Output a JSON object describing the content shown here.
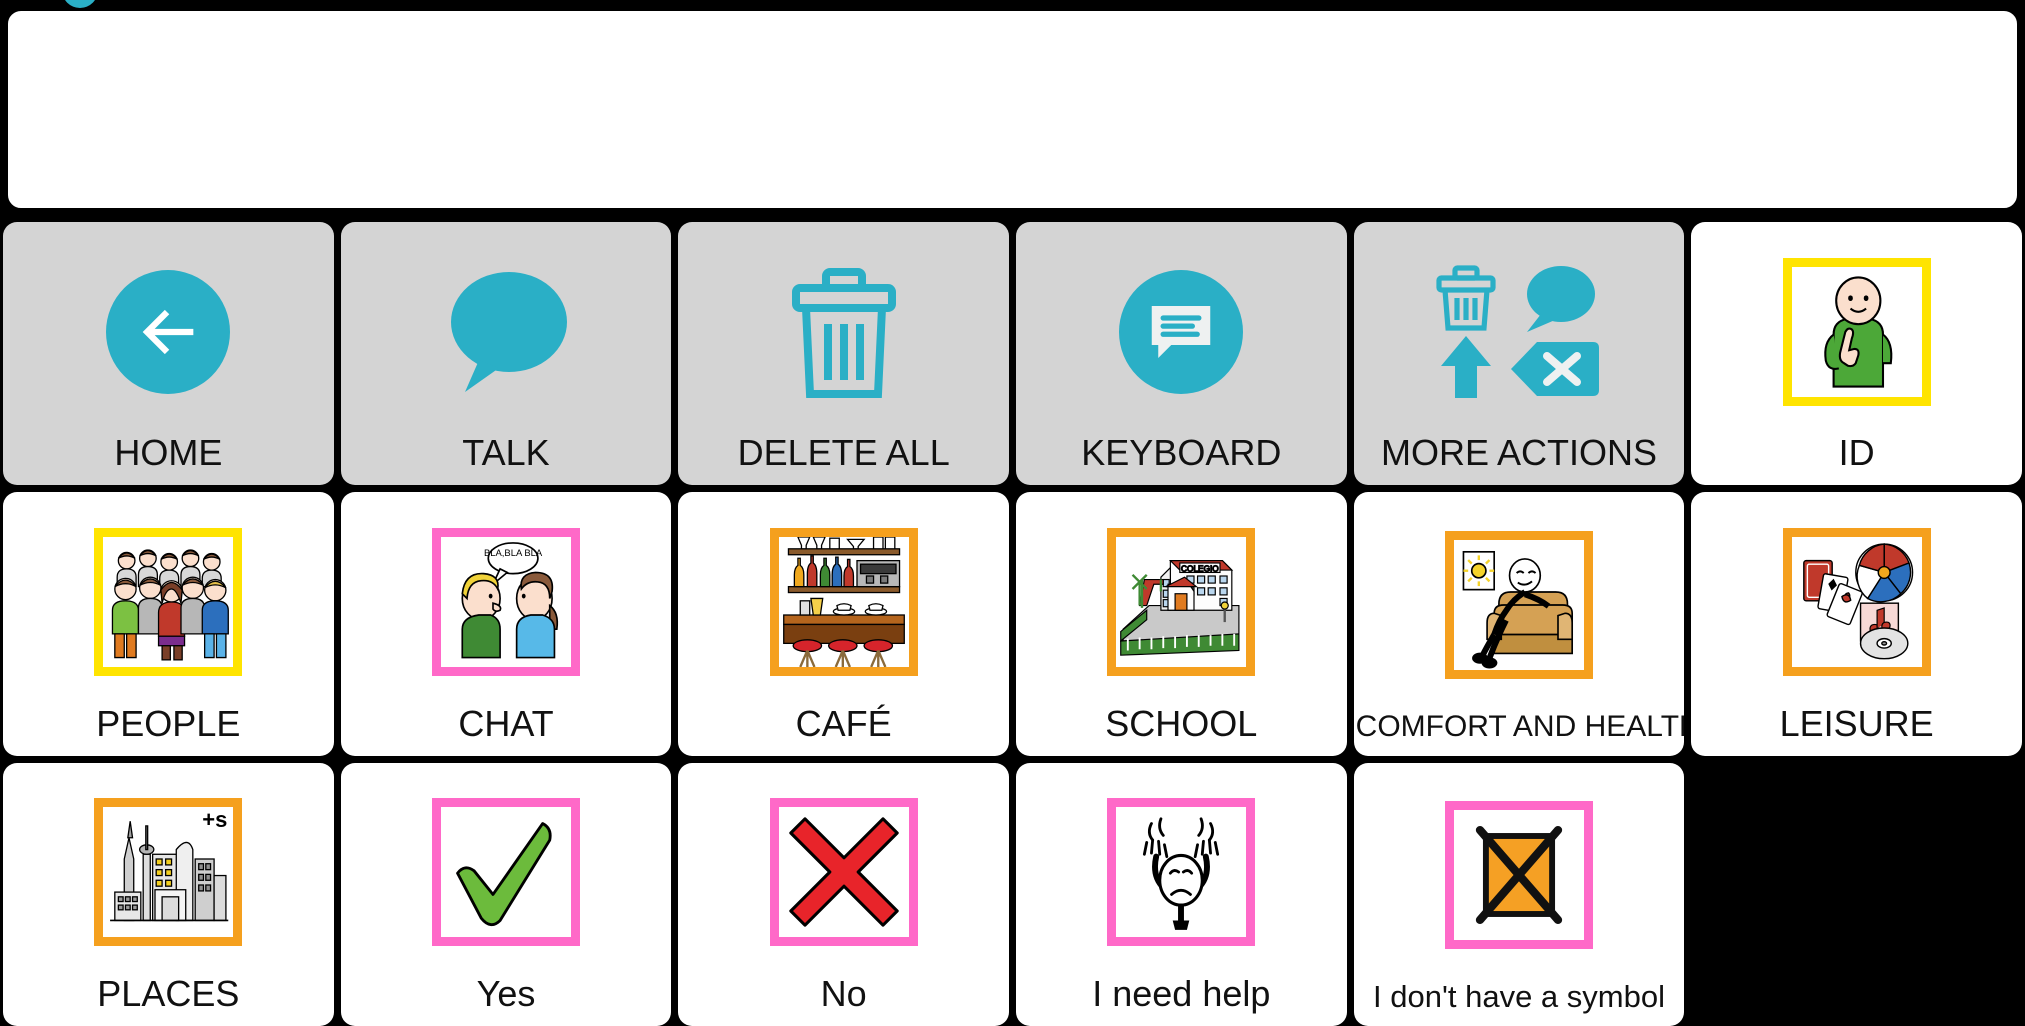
{
  "app": {
    "accent_teal": "#2aafc6",
    "toolbar_bg": "#d4d4d4",
    "frame_yellow": "#ffe400",
    "frame_pink": "#ff69c8",
    "frame_orange": "#f5a01e"
  },
  "message_bar": {
    "value": "",
    "placeholder": ""
  },
  "grid": {
    "columns": 6,
    "rows": 3,
    "cells": [
      {
        "label": "HOME",
        "icon": "back-arrow-icon",
        "kind": "toolbar"
      },
      {
        "label": "TALK",
        "icon": "speech-bubble-icon",
        "kind": "toolbar"
      },
      {
        "label": "DELETE ALL",
        "icon": "trash-can-icon",
        "kind": "toolbar"
      },
      {
        "label": "KEYBOARD",
        "icon": "keyboard-chat-icon",
        "kind": "toolbar"
      },
      {
        "label": "MORE ACTIONS",
        "icon": "more-actions-icon",
        "kind": "toolbar"
      },
      {
        "label": "ID",
        "icon": "person-pointing-self-icon",
        "kind": "symbol",
        "frame": "yellow"
      },
      {
        "label": "PEOPLE",
        "icon": "group-of-people-icon",
        "kind": "symbol",
        "frame": "yellow"
      },
      {
        "label": "CHAT",
        "icon": "two-people-talking-icon",
        "kind": "symbol",
        "frame": "pink",
        "bubble_text": "BLA,BLA BLA"
      },
      {
        "label": "CAFÉ",
        "icon": "bar-counter-icon",
        "kind": "symbol",
        "frame": "orange"
      },
      {
        "label": "SCHOOL",
        "icon": "school-building-icon",
        "kind": "symbol",
        "frame": "orange",
        "sign_text": "COLEGIO"
      },
      {
        "label": "COMFORT AND HEALTH",
        "icon": "person-in-armchair-icon",
        "kind": "symbol",
        "frame": "orange"
      },
      {
        "label": "LEISURE",
        "icon": "cards-ball-music-icon",
        "kind": "symbol",
        "frame": "orange"
      },
      {
        "label": "PLACES",
        "icon": "city-skyline-icon",
        "kind": "symbol",
        "frame": "orange",
        "plural": "+s"
      },
      {
        "label": "Yes",
        "icon": "green-check-icon",
        "kind": "symbol",
        "frame": "pink"
      },
      {
        "label": "No",
        "icon": "red-cross-icon",
        "kind": "symbol",
        "frame": "pink"
      },
      {
        "label": "I need help",
        "icon": "distressed-person-icon",
        "kind": "symbol",
        "frame": "pink"
      },
      {
        "label": "I don't have a symbol",
        "icon": "crossed-out-box-icon",
        "kind": "symbol",
        "frame": "pink"
      },
      {
        "label": "",
        "icon": "",
        "kind": "empty"
      }
    ]
  }
}
